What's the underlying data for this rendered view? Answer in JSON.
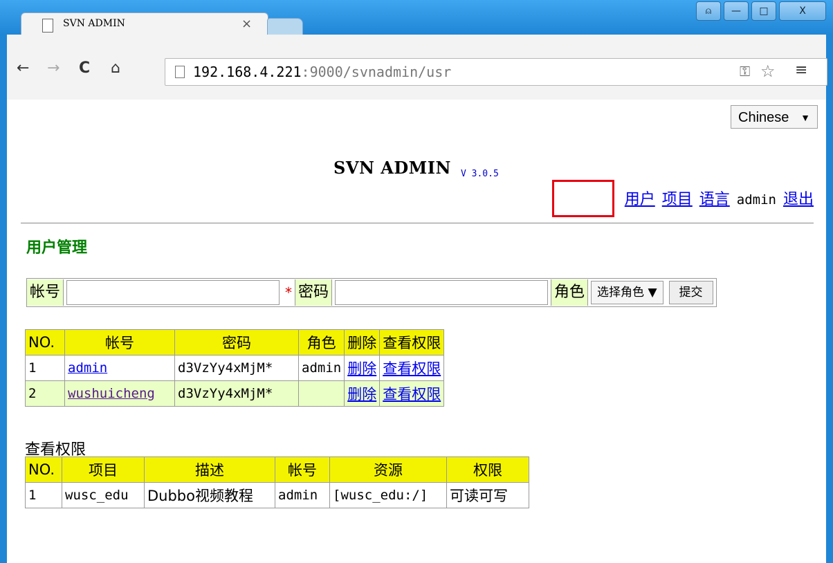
{
  "browser": {
    "tab_title": "SVN ADMIN",
    "tab_close": "×",
    "url_host": "192.168.4.221",
    "url_path": ":9000/svnadmin/usr",
    "nav_back": "←",
    "nav_forward": "→",
    "nav_reload": "C",
    "nav_home": "⌂",
    "window_buttons": {
      "user": "⍝",
      "minimize": "—",
      "maximize": "□",
      "close": "X"
    }
  },
  "language_select": {
    "value": "Chinese",
    "arrow": "▼"
  },
  "app": {
    "title": "SVN ADMIN",
    "version": "V 3.0.5"
  },
  "topnav": {
    "users": "用户",
    "projects": "项目",
    "language": "语言",
    "current_user": "admin",
    "logout": "退出"
  },
  "section_title": "用户管理",
  "form": {
    "account_label": "帐号",
    "account_value": "",
    "required_mark": "*",
    "password_label": "密码",
    "password_value": "",
    "role_label": "角色",
    "role_select": "选择角色 ▼",
    "submit": "提交"
  },
  "user_table": {
    "headers": [
      "NO.",
      "帐号",
      "密码",
      "角色",
      "删除",
      "查看权限"
    ],
    "rows": [
      {
        "no": "1",
        "account": "admin",
        "password": "d3VzYy4xMjM*",
        "role": "admin",
        "delete": "删除",
        "view": "查看权限"
      },
      {
        "no": "2",
        "account": "wushuicheng",
        "password": "d3VzYy4xMjM*",
        "role": "",
        "delete": "删除",
        "view": "查看权限"
      }
    ]
  },
  "permissions": {
    "heading": "查看权限",
    "headers": [
      "NO.",
      "项目",
      "描述",
      "帐号",
      "资源",
      "权限"
    ],
    "rows": [
      {
        "no": "1",
        "project": "wusc_edu",
        "description": "Dubbo视频教程",
        "account": "admin",
        "resource": "[wusc_edu:/]",
        "permission": "可读可写"
      }
    ]
  },
  "colors": {
    "header_yellow": "#f3f300",
    "label_green": "#eaffc6",
    "section_green": "#008000",
    "highlight_red": "#e60012",
    "link_blue": "#0000ee"
  }
}
